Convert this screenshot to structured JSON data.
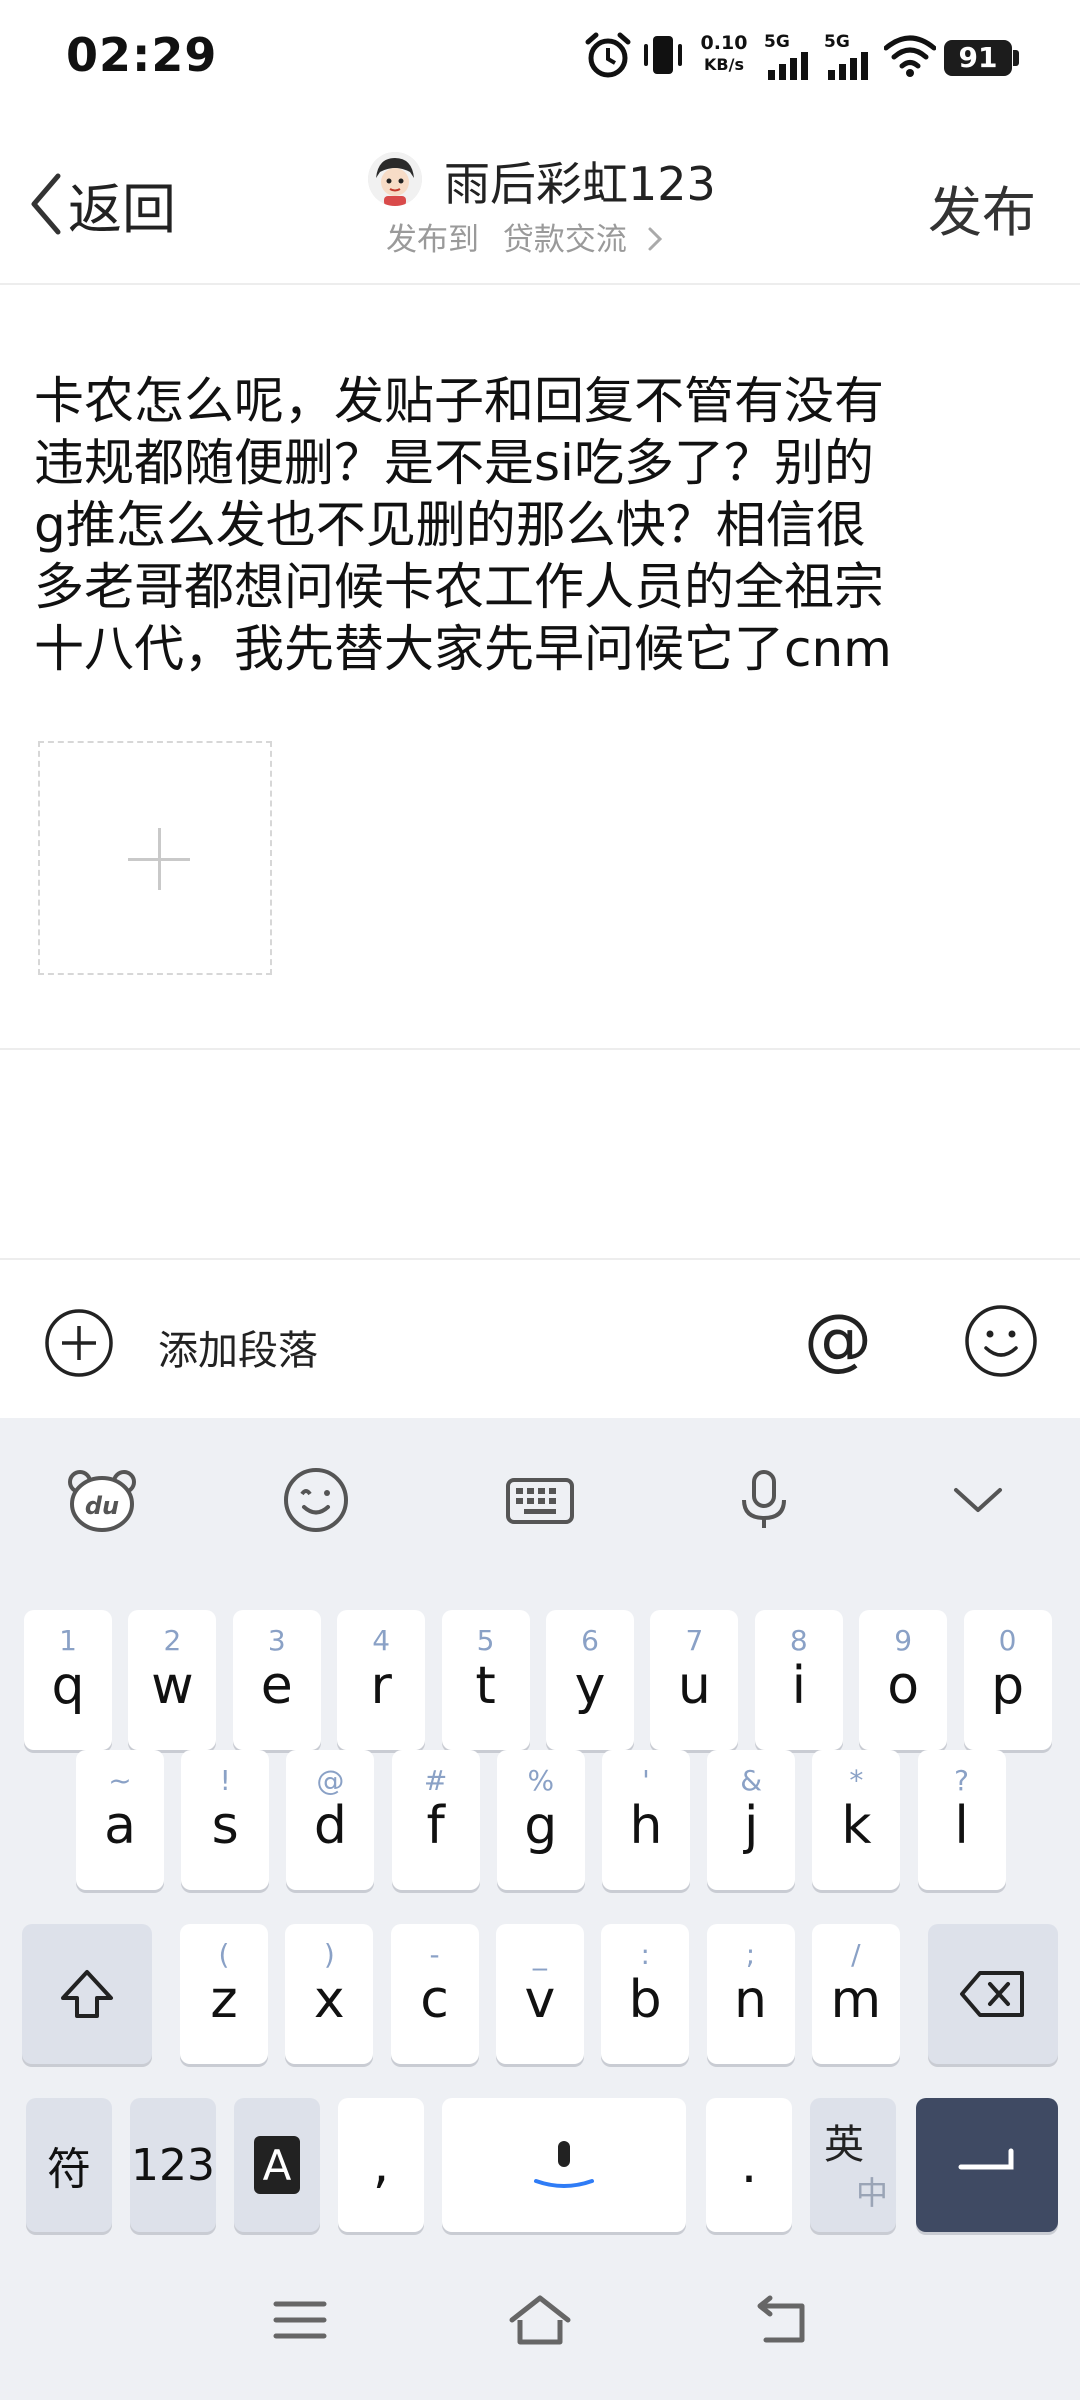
{
  "status_bar": {
    "time": "02:29",
    "net_speed_value": "0.10",
    "net_speed_unit": "KB/s",
    "signal1_label": "5G",
    "signal2_label": "5G",
    "battery": "91"
  },
  "header": {
    "back_label": "返回",
    "author_name": "雨后彩虹123",
    "post_to_label": "发布到",
    "forum_name": "贷款交流",
    "publish_label": "发布"
  },
  "editor": {
    "content": "卡农怎么呢，发贴子和回复不管有没有\n违规都随便删？是不是si吃多了？别的\ng推怎么发也不见删的那么快？相信很\n多老哥都想问候卡农工作人员的全祖宗\n十八代，我先替大家先早问候它了cnm"
  },
  "toolbar": {
    "add_paragraph_label": "添加段落",
    "at_label": "@"
  },
  "keyboard": {
    "row1": [
      {
        "hint": "1",
        "key": "q"
      },
      {
        "hint": "2",
        "key": "w"
      },
      {
        "hint": "3",
        "key": "e"
      },
      {
        "hint": "4",
        "key": "r"
      },
      {
        "hint": "5",
        "key": "t"
      },
      {
        "hint": "6",
        "key": "y"
      },
      {
        "hint": "7",
        "key": "u"
      },
      {
        "hint": "8",
        "key": "i"
      },
      {
        "hint": "9",
        "key": "o"
      },
      {
        "hint": "0",
        "key": "p"
      }
    ],
    "row2": [
      {
        "hint": "~",
        "key": "a"
      },
      {
        "hint": "!",
        "key": "s"
      },
      {
        "hint": "@",
        "key": "d"
      },
      {
        "hint": "#",
        "key": "f"
      },
      {
        "hint": "%",
        "key": "g"
      },
      {
        "hint": "'",
        "key": "h"
      },
      {
        "hint": "&",
        "key": "j"
      },
      {
        "hint": "*",
        "key": "k"
      },
      {
        "hint": "?",
        "key": "l"
      }
    ],
    "row3": [
      {
        "hint": "(",
        "key": "z"
      },
      {
        "hint": ")",
        "key": "x"
      },
      {
        "hint": "-",
        "key": "c"
      },
      {
        "hint": "_",
        "key": "v"
      },
      {
        "hint": ":",
        "key": "b"
      },
      {
        "hint": ";",
        "key": "n"
      },
      {
        "hint": "/",
        "key": "m"
      }
    ],
    "symbol_label": "符",
    "numbers_label": "123",
    "case_label": "A",
    "comma_label": ",",
    "period_label": ".",
    "lang_top": "英",
    "lang_bottom": "中"
  },
  "colors": {
    "accent_blue": "#2f7cf6",
    "enter_key": "#3f4a63",
    "hint_text": "#8aa1c6"
  }
}
